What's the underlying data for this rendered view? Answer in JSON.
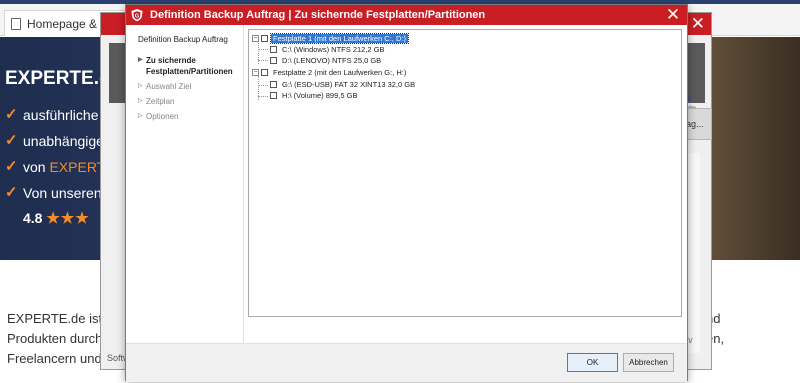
{
  "background": {
    "browser_tab": "Homepage & Ho",
    "hero_title": "EXPERTE.de",
    "features": [
      {
        "text": "ausführliche F",
        "highlight": ""
      },
      {
        "text": "unabhängige ",
        "highlight": ""
      },
      {
        "text": "von ",
        "highlight": "EXPERT"
      },
      {
        "text": "Von unseren ",
        "highlight": ""
      }
    ],
    "rating_value": "4.8",
    "rating_stars": "★★★",
    "paragraph_lines": [
      "EXPERTE.de ist d",
      "Produkten durch u",
      "Freelancern und k"
    ],
    "paragraph_right_lines": [
      "nd",
      "en,"
    ]
  },
  "window2": {
    "close_glyph": "✕",
    "field_text": "rag...",
    "status_text": "Softw",
    "icons": "✎ 📋"
  },
  "dialog": {
    "title": "Definition Backup Auftrag | Zu sichernde Festplatten/Partitionen",
    "close_glyph": "✕",
    "sidebar": {
      "title": "Definition Backup Auftrag",
      "steps": [
        {
          "label": "Zu sichernde Festplatten/Partitionen",
          "active": true
        },
        {
          "label": "Auswahl Ziel",
          "active": false
        },
        {
          "label": "Zeitplan",
          "active": false
        },
        {
          "label": "Optionen",
          "active": false
        }
      ]
    },
    "tree": {
      "disks": [
        {
          "label": "Festplatte 1 (mit den Laufwerken C:, D:)",
          "selected": true,
          "expander": "−",
          "partitions": [
            {
              "label": "C:\\ (Windows) NTFS 212,2 GB"
            },
            {
              "label": "D:\\ (LENOVO) NTFS 25,0 GB"
            }
          ]
        },
        {
          "label": "Festplatte 2 (mit den Laufwerken G:, H:)",
          "selected": false,
          "expander": "−",
          "partitions": [
            {
              "label": "G:\\ (ESD-USB) FAT 32 XINT13 32,0 GB"
            },
            {
              "label": "H:\\ (Volume)  899,5 GB"
            }
          ]
        }
      ]
    },
    "buttons": {
      "ok": "OK",
      "cancel": "Abbrechen"
    },
    "colors": {
      "titlebar": "#c81e24",
      "selection": "#3178d6"
    }
  }
}
